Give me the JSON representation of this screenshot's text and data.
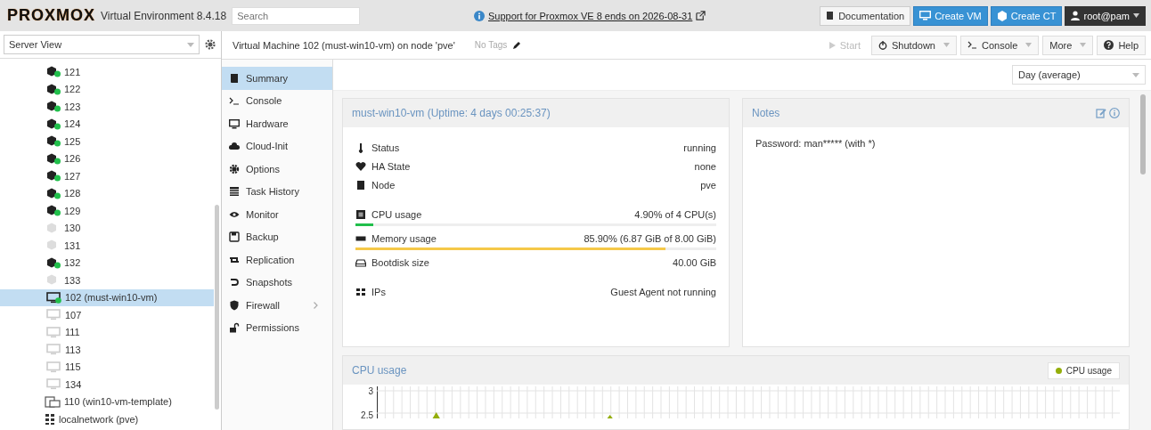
{
  "topbar": {
    "brand": "PROXMOX",
    "product": "Virtual Environment 8.4.18",
    "search": {
      "placeholder": "Search"
    },
    "notice": "Support for Proxmox VE 8 ends on 2026-08-31",
    "buttons": [
      {
        "label": "Documentation",
        "kind": "doc"
      },
      {
        "label": "Create VM",
        "kind": "vm"
      },
      {
        "label": "Create CT",
        "kind": "ct"
      },
      {
        "label": "root@pam",
        "kind": "user"
      }
    ]
  },
  "sidebar": {
    "view": "Server View",
    "items": [
      {
        "label": "121",
        "kind": "ct",
        "running": true,
        "selected": false
      },
      {
        "label": "122",
        "kind": "ct",
        "running": true,
        "selected": false
      },
      {
        "label": "123",
        "kind": "ct",
        "running": true,
        "selected": false
      },
      {
        "label": "124",
        "kind": "ct",
        "running": true,
        "selected": false
      },
      {
        "label": "125",
        "kind": "ct",
        "running": true,
        "selected": false
      },
      {
        "label": "126",
        "kind": "ct",
        "running": true,
        "selected": false
      },
      {
        "label": "127",
        "kind": "ct",
        "running": true,
        "selected": false
      },
      {
        "label": "128",
        "kind": "ct",
        "running": true,
        "selected": false
      },
      {
        "label": "129",
        "kind": "ct",
        "running": true,
        "selected": false
      },
      {
        "label": "130",
        "kind": "ct",
        "running": false,
        "selected": false
      },
      {
        "label": "131",
        "kind": "ct",
        "running": false,
        "selected": false
      },
      {
        "label": "132",
        "kind": "ct",
        "running": true,
        "selected": false
      },
      {
        "label": "133",
        "kind": "ct",
        "running": false,
        "selected": false
      },
      {
        "label": "102 (must-win10-vm)",
        "kind": "vm",
        "running": true,
        "selected": true
      },
      {
        "label": "107",
        "kind": "vm",
        "running": false,
        "selected": false
      },
      {
        "label": "111",
        "kind": "vm",
        "running": false,
        "selected": false
      },
      {
        "label": "113",
        "kind": "vm",
        "running": false,
        "selected": false
      },
      {
        "label": "115",
        "kind": "vm",
        "running": false,
        "selected": false
      },
      {
        "label": "134",
        "kind": "vm",
        "running": false,
        "selected": false
      },
      {
        "label": "110 (win10-vm-template)",
        "kind": "template",
        "selected": false
      },
      {
        "label": "localnetwork (pve)",
        "kind": "network",
        "selected": false
      }
    ]
  },
  "header": {
    "title": "Virtual Machine 102 (must-win10-vm) on node 'pve'",
    "tags": "No Tags",
    "actions": [
      {
        "label": "Start",
        "kind": "start",
        "disabled": true,
        "menu": false
      },
      {
        "label": "Shutdown",
        "kind": "shutdown",
        "disabled": false,
        "menu": true
      },
      {
        "label": "Console",
        "kind": "console",
        "disabled": false,
        "menu": true
      },
      {
        "label": "More",
        "kind": "more",
        "disabled": false,
        "menu": true
      },
      {
        "label": "Help",
        "kind": "help",
        "disabled": false,
        "menu": false
      }
    ]
  },
  "nav": [
    {
      "label": "Summary",
      "kind": "book",
      "selected": true,
      "expandable": false
    },
    {
      "label": "Console",
      "kind": "term",
      "selected": false,
      "expandable": false
    },
    {
      "label": "Hardware",
      "kind": "monitor",
      "selected": false,
      "expandable": false
    },
    {
      "label": "Cloud-Init",
      "kind": "cloud",
      "selected": false,
      "expandable": false
    },
    {
      "label": "Options",
      "kind": "gear",
      "selected": false,
      "expandable": false
    },
    {
      "label": "Task History",
      "kind": "list",
      "selected": false,
      "expandable": false
    },
    {
      "label": "Monitor",
      "kind": "eye",
      "selected": false,
      "expandable": false
    },
    {
      "label": "Backup",
      "kind": "floppy",
      "selected": false,
      "expandable": false
    },
    {
      "label": "Replication",
      "kind": "retweet",
      "selected": false,
      "expandable": false
    },
    {
      "label": "Snapshots",
      "kind": "undo",
      "selected": false,
      "expandable": false
    },
    {
      "label": "Firewall",
      "kind": "shield",
      "selected": false,
      "expandable": true
    },
    {
      "label": "Permissions",
      "kind": "unlock",
      "selected": false,
      "expandable": false
    }
  ],
  "timeframe": "Day (average)",
  "status": {
    "title": "must-win10-vm (Uptime: 4 days 00:25:37)",
    "rows": [
      {
        "label": "Status",
        "value": "running",
        "kind": "therm"
      },
      {
        "label": "HA State",
        "value": "none",
        "kind": "heart"
      },
      {
        "label": "Node",
        "value": "pve",
        "kind": "server"
      },
      {
        "label": "CPU usage",
        "value": "4.90% of 4 CPU(s)",
        "kind": "cpu",
        "level": 0.049
      },
      {
        "label": "Memory usage",
        "value": "85.90% (6.87 GiB of 8.00 GiB)",
        "kind": "mem",
        "level": 0.859
      },
      {
        "label": "Bootdisk size",
        "value": "40.00 GiB",
        "kind": "hdd"
      },
      {
        "label": "IPs",
        "value": "Guest Agent not running",
        "kind": "net"
      }
    ]
  },
  "notes": {
    "title": "Notes",
    "text": "Password: man***** (with *)"
  },
  "cpu_chart": {
    "title": "CPU usage",
    "legend": [
      {
        "label": "CPU usage",
        "color": "#94ae0a"
      }
    ],
    "yticks": [
      "3",
      "2.5"
    ]
  }
}
